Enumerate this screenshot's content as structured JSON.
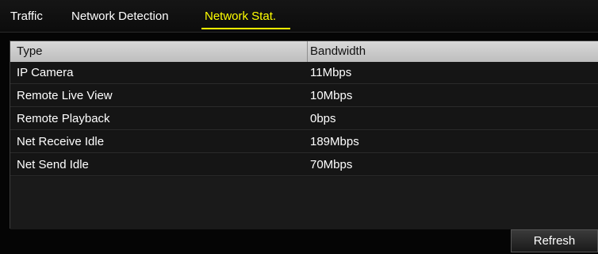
{
  "tabs": [
    {
      "label": "Traffic",
      "active": false
    },
    {
      "label": "Network Detection",
      "active": false
    },
    {
      "label": "Network Stat.",
      "active": true
    }
  ],
  "table": {
    "columns": [
      "Type",
      "Bandwidth"
    ],
    "rows": [
      {
        "type": "IP Camera",
        "bandwidth": "11Mbps"
      },
      {
        "type": "Remote Live View",
        "bandwidth": "10Mbps"
      },
      {
        "type": "Remote Playback",
        "bandwidth": "0bps"
      },
      {
        "type": "Net Receive Idle",
        "bandwidth": "189Mbps"
      },
      {
        "type": "Net Send Idle",
        "bandwidth": "70Mbps"
      }
    ]
  },
  "buttons": {
    "refresh": "Refresh"
  },
  "colors": {
    "active_tab": "#ffff00",
    "background": "#000000",
    "header_bg": "#cfcfcf"
  }
}
